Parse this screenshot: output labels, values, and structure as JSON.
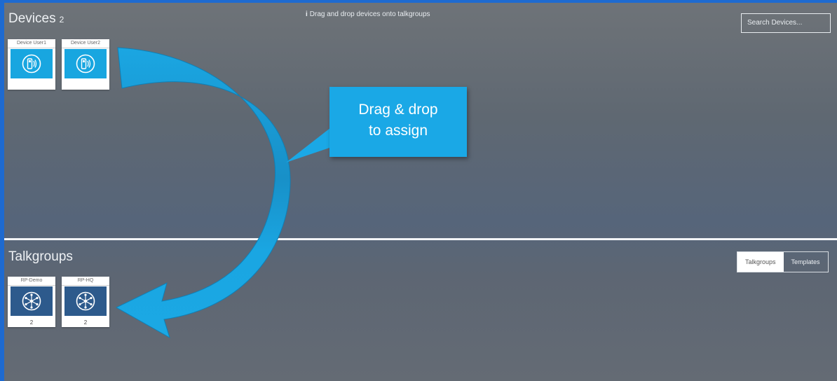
{
  "devices": {
    "title": "Devices",
    "count": "2",
    "hint_icon": "i",
    "hint_text": "Drag and drop devices onto talkgroups",
    "search_placeholder": "Search Devices...",
    "items": [
      {
        "label": "Device User1",
        "icon": "radio-icon"
      },
      {
        "label": "Device User2",
        "icon": "radio-icon"
      }
    ]
  },
  "talkgroups": {
    "title": "Talkgroups",
    "tabs": [
      {
        "label": "Talkgroups",
        "active": true
      },
      {
        "label": "Templates",
        "active": false
      }
    ],
    "items": [
      {
        "label": "RP-Demo",
        "count": "2",
        "icon": "talkgroup-icon"
      },
      {
        "label": "RP-HQ",
        "count": "2",
        "icon": "talkgroup-icon"
      }
    ]
  },
  "callout": {
    "line1": "Drag & drop",
    "line2": "to assign"
  },
  "colors": {
    "frame_border": "#1e6ad0",
    "device_tile": "#18a6e0",
    "talkgroup_tile": "#2d5a8c",
    "callout": "#1aa8e6"
  }
}
